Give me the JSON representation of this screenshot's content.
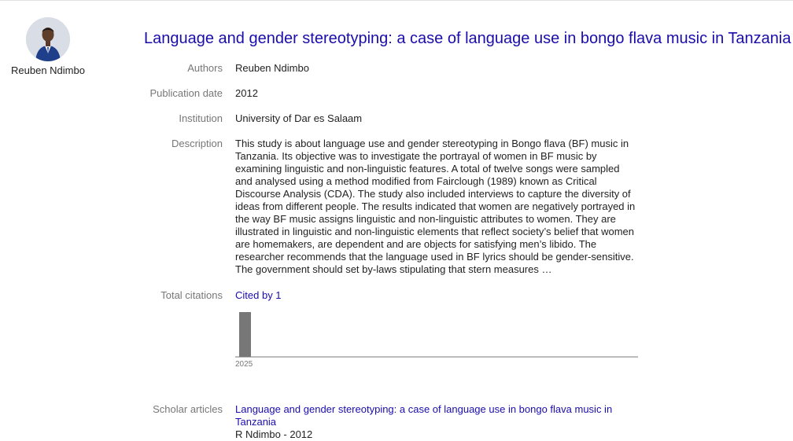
{
  "profile": {
    "name": "Reuben Ndimbo"
  },
  "title": "Language and gender stereotyping: a case of language use in bongo flava music in Tanzania",
  "fields": {
    "authors": {
      "label": "Authors",
      "value": "Reuben Ndimbo"
    },
    "publication_date": {
      "label": "Publication date",
      "value": "2012"
    },
    "institution": {
      "label": "Institution",
      "value": "University of Dar es Salaam"
    },
    "description": {
      "label": "Description",
      "value": "This study is about language use and gender stereotyping in Bongo flava (BF) music in Tanzania. Its objective was to investigate the portrayal of women in BF music by examining linguistic and non-linguistic features. A total of twelve songs were sampled and analysed using a method modified from Fairclough (1989) known as Critical Discourse Analysis (CDA). The study also included interviews to capture the diversity of ideas from different people. The results indicated that women are negatively portrayed in the way BF music assigns linguistic and non-linguistic attributes to women. They are illustrated in linguistic and non-linguistic elements that reflect society’s belief that women are homemakers, are dependent and are objects for satisfying men’s libido. The researcher recommends that the language used in BF lyrics should be gender-sensitive. The government should set by-laws stipulating that stern measures …"
    },
    "total_citations": {
      "label": "Total citations",
      "cited_by": "Cited by 1"
    },
    "scholar_articles": {
      "label": "Scholar articles",
      "article_title": "Language and gender stereotyping: a case of language use in bongo flava music in Tanzania",
      "article_sub": "R Ndimbo - 2012"
    }
  },
  "chart_data": {
    "type": "bar",
    "categories": [
      "2025"
    ],
    "values": [
      1
    ],
    "bar_color": "#777777"
  }
}
